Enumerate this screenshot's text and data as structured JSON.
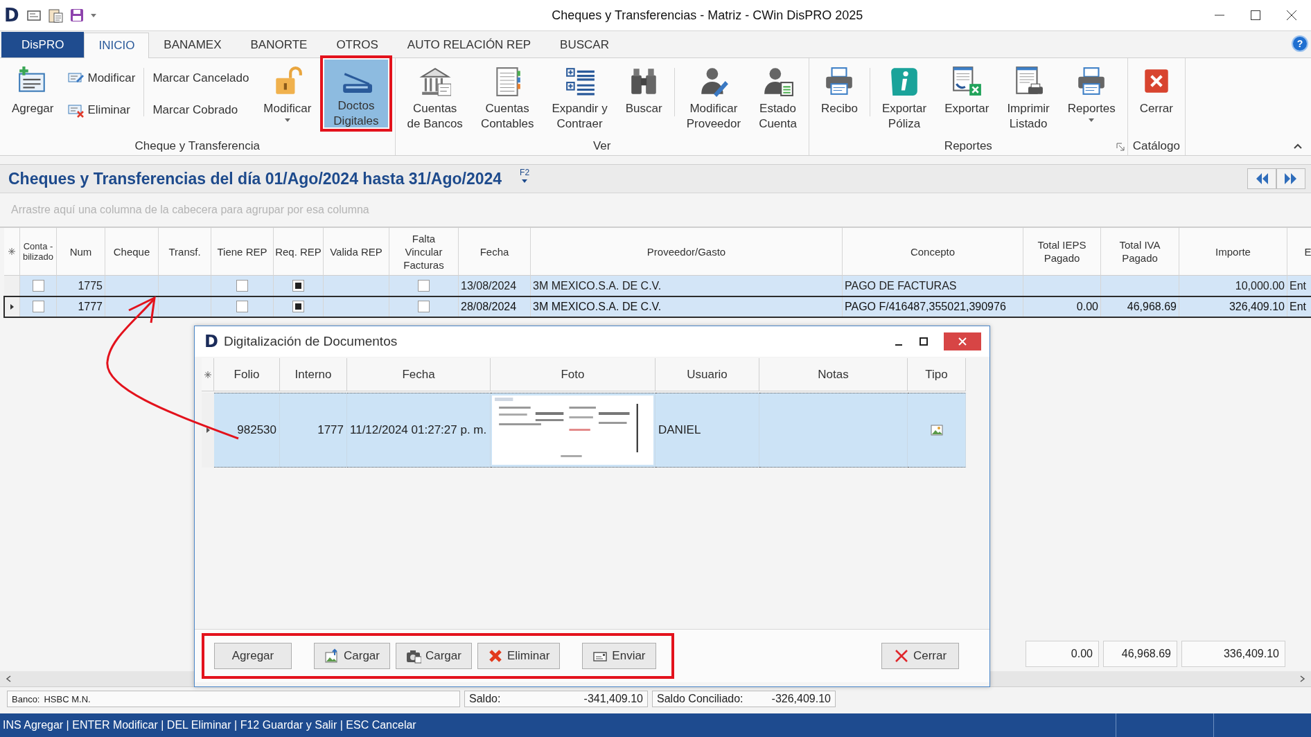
{
  "window": {
    "logo": "D",
    "title": "Cheques y Transferencias - Matriz - CWin DisPRO 2025"
  },
  "ribbon_tabs": [
    {
      "label": "DisPRO",
      "kind": "file",
      "selected": false
    },
    {
      "label": "INICIO",
      "kind": "tab",
      "selected": true
    },
    {
      "label": "BANAMEX",
      "kind": "tab",
      "selected": false
    },
    {
      "label": "BANORTE",
      "kind": "tab",
      "selected": false
    },
    {
      "label": "OTROS",
      "kind": "tab",
      "selected": false
    },
    {
      "label": "AUTO RELACIÓN REP",
      "kind": "tab",
      "selected": false
    },
    {
      "label": "BUSCAR",
      "kind": "tab",
      "selected": false
    }
  ],
  "help_button": {
    "glyph": "?"
  },
  "ribbon_groups": [
    {
      "label": "Cheque y Transferencia",
      "launcher": false,
      "items": [
        {
          "kind": "large",
          "label": "Agregar",
          "selected": false,
          "highlighted": false
        },
        {
          "kind": "small-stack",
          "items": [
            {
              "label": "Modificar"
            },
            {
              "label": "Eliminar"
            }
          ]
        },
        {
          "kind": "text-stack",
          "separator_before": true,
          "items": [
            {
              "label": "Marcar Cancelado"
            },
            {
              "label": "Marcar Cobrado"
            }
          ]
        },
        {
          "kind": "large",
          "label": "Modificar",
          "dropdown": true,
          "selected": false,
          "highlighted": false
        },
        {
          "kind": "large",
          "label": "Doctos\nDigitales",
          "selected": true,
          "highlighted": true
        }
      ]
    },
    {
      "label": "Ver",
      "launcher": false,
      "items": [
        {
          "kind": "large",
          "label": "Cuentas\nde Bancos",
          "selected": false,
          "highlighted": false
        },
        {
          "kind": "large",
          "label": "Cuentas\nContables",
          "selected": false,
          "highlighted": false
        },
        {
          "kind": "large",
          "label": "Expandir y\nContraer",
          "selected": false,
          "highlighted": false
        },
        {
          "kind": "large",
          "label": "Buscar",
          "selected": false,
          "highlighted": false
        },
        {
          "kind": "large",
          "label": "Modificar\nProveedor",
          "separator_before": true,
          "selected": false,
          "highlighted": false
        },
        {
          "kind": "large",
          "label": "Estado\nCuenta",
          "selected": false,
          "highlighted": false
        }
      ]
    },
    {
      "label": "Reportes",
      "launcher": true,
      "items": [
        {
          "kind": "large",
          "label": "Recibo",
          "selected": false,
          "highlighted": false
        },
        {
          "kind": "large",
          "label": "Exportar\nPóliza",
          "separator_before": true,
          "selected": false,
          "highlighted": false
        },
        {
          "kind": "large",
          "label": "Exportar",
          "selected": false,
          "highlighted": false
        },
        {
          "kind": "large",
          "label": "Imprimir\nListado",
          "selected": false,
          "highlighted": false
        },
        {
          "kind": "large",
          "label": "Reportes",
          "dropdown": true,
          "selected": false,
          "highlighted": false
        }
      ]
    },
    {
      "label": "Catálogo",
      "launcher": false,
      "items": [
        {
          "kind": "large",
          "label": "Cerrar",
          "selected": false,
          "highlighted": false
        }
      ]
    }
  ],
  "grid": {
    "title": "Cheques y Transferencias del día 01/Ago/2024 hasta 31/Ago/2024",
    "title_hint": "F2",
    "group_panel_hint": "Arrastre aquí una columna de la cabecera para agrupar por esa columna",
    "columns": [
      {
        "label": "Conta -\nbilizado",
        "kind": "check"
      },
      {
        "label": "Num",
        "kind": "number"
      },
      {
        "label": "Cheque",
        "kind": "text"
      },
      {
        "label": "Transf.",
        "kind": "text"
      },
      {
        "label": "Tiene REP",
        "kind": "check"
      },
      {
        "label": "Req. REP",
        "kind": "check"
      },
      {
        "label": "Valida REP",
        "kind": "text"
      },
      {
        "label": "Falta\nVincular\nFacturas",
        "kind": "check"
      },
      {
        "label": "Fecha",
        "kind": "text"
      },
      {
        "label": "Proveedor/Gasto",
        "kind": "text"
      },
      {
        "label": "Concepto",
        "kind": "text"
      },
      {
        "label": "Total IEPS\nPagado",
        "kind": "number"
      },
      {
        "label": "Total IVA\nPagado",
        "kind": "number"
      },
      {
        "label": "Importe",
        "kind": "number"
      },
      {
        "label": "E",
        "kind": "text"
      }
    ],
    "rows": [
      {
        "current": false,
        "cells": [
          {
            "checked": false
          },
          "1775",
          null,
          null,
          {
            "checked": false
          },
          {
            "checked": true
          },
          null,
          {
            "checked": false
          },
          "13/08/2024",
          "3M MEXICO.S.A. DE C.V.",
          "PAGO DE FACTURAS",
          null,
          null,
          "10,000.00",
          "Ent"
        ]
      },
      {
        "current": true,
        "cells": [
          {
            "checked": false
          },
          "1777",
          null,
          null,
          {
            "checked": false
          },
          {
            "checked": true
          },
          null,
          {
            "checked": false
          },
          "28/08/2024",
          "3M MEXICO.S.A. DE C.V.",
          "PAGO F/416487,355021,390976",
          "0.00",
          "46,968.69",
          "326,409.10",
          "Ent"
        ]
      }
    ],
    "totals": {
      "total_ieps_pagado": "0.00",
      "total_iva_pagado": "46,968.69",
      "importe": "336,409.10"
    }
  },
  "status_fields": [
    {
      "label": "Banco:",
      "value": "HSBC M.N.",
      "kind": "bank"
    },
    {
      "label": "Saldo:",
      "value": "-341,409.10",
      "kind": "amount"
    },
    {
      "label": "Saldo Conciliado:",
      "value": "-326,409.10",
      "kind": "amount"
    }
  ],
  "shortcut_bar": "INS Agregar | ENTER Modificar | DEL Eliminar | F12 Guardar y Salir | ESC Cancelar",
  "dialog": {
    "logo": "D",
    "title": "Digitalización de Documentos",
    "columns": [
      {
        "label": "Folio",
        "kind": "number"
      },
      {
        "label": "Interno",
        "kind": "number"
      },
      {
        "label": "Fecha",
        "kind": "text"
      },
      {
        "label": "Foto",
        "kind": "picture"
      },
      {
        "label": "Usuario",
        "kind": "text"
      },
      {
        "label": "Notas",
        "kind": "text"
      },
      {
        "label": "Tipo",
        "kind": "icon"
      }
    ],
    "rows": [
      {
        "current": true,
        "cells": [
          "982530",
          "1777",
          "11/12/2024 01:27:27 p. m.",
          {
            "kind": "picture"
          },
          "DANIEL",
          null,
          {
            "kind": "icon"
          }
        ]
      }
    ],
    "button_group": {
      "highlighted": true,
      "buttons": [
        {
          "label": "Agregar"
        },
        {
          "label": "Cargar"
        },
        {
          "label": "Cargar"
        },
        {
          "label": "Eliminar"
        },
        {
          "label": "Enviar"
        }
      ]
    },
    "close_button": {
      "label": "Cerrar"
    }
  },
  "annotations": [
    {
      "kind": "arrow"
    }
  ]
}
